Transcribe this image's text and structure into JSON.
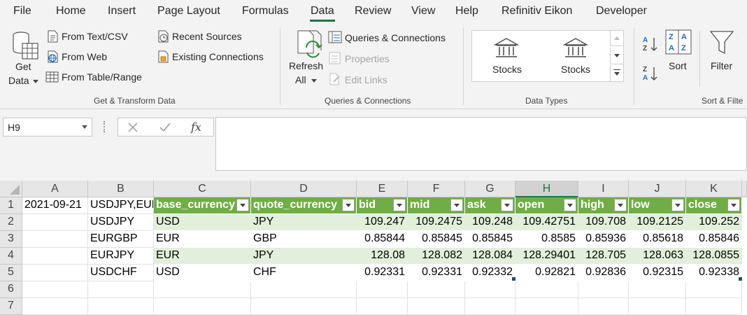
{
  "menu": {
    "tabs": [
      "File",
      "Home",
      "Insert",
      "Page Layout",
      "Formulas",
      "Data",
      "Review",
      "View",
      "Help",
      "Refinitiv Eikon",
      "Developer"
    ],
    "active": "Data"
  },
  "ribbon": {
    "get_transform": {
      "get_data_line1": "Get",
      "get_data_line2": "Data",
      "from_text_csv": "From Text/CSV",
      "from_web": "From Web",
      "from_table_range": "From Table/Range",
      "recent_sources": "Recent Sources",
      "existing_connections": "Existing Connections",
      "label": "Get & Transform Data"
    },
    "queries": {
      "refresh_line1": "Refresh",
      "refresh_line2": "All",
      "queries_connections": "Queries & Connections",
      "properties": "Properties",
      "edit_links": "Edit Links",
      "label": "Queries & Connections"
    },
    "data_types": {
      "items": [
        "Stocks",
        "Stocks"
      ],
      "label": "Data Types"
    },
    "sort_filter": {
      "sort": "Sort",
      "filter": "Filter",
      "label": "Sort & Filte"
    }
  },
  "formula_bar": {
    "name_box": "H9",
    "fx": "fx",
    "formula": ""
  },
  "sheet": {
    "columns": [
      "A",
      "B",
      "C",
      "D",
      "E",
      "F",
      "G",
      "H",
      "I",
      "J",
      "K"
    ],
    "selected_column": "H",
    "rows": [
      "1",
      "2",
      "3",
      "4",
      "5",
      "6",
      "7"
    ],
    "a1": "2021-09-21",
    "b1": "USDJPY,EUR",
    "b_col": [
      "USDJPY",
      "EURGBP",
      "EURJPY",
      "USDCHF"
    ],
    "table_headers": [
      "base_currency",
      "quote_currency",
      "bid",
      "mid",
      "ask",
      "open",
      "high",
      "low",
      "close"
    ],
    "table_rows": [
      [
        "USD",
        "JPY",
        "109.247",
        "109.2475",
        "109.248",
        "109.42751",
        "109.708",
        "109.2125",
        "109.252"
      ],
      [
        "EUR",
        "GBP",
        "0.85844",
        "0.85845",
        "0.85845",
        "0.8585",
        "0.85936",
        "0.85618",
        "0.85846"
      ],
      [
        "EUR",
        "JPY",
        "128.08",
        "128.082",
        "128.084",
        "128.29401",
        "128.705",
        "128.063",
        "128.0855"
      ],
      [
        "USD",
        "CHF",
        "0.92331",
        "0.92331",
        "0.92332",
        "0.92821",
        "0.92836",
        "0.92315",
        "0.92338"
      ]
    ],
    "colors": {
      "header_bg": "#70ad47",
      "band_bg": "#e2efda",
      "accent": "#217346"
    }
  }
}
